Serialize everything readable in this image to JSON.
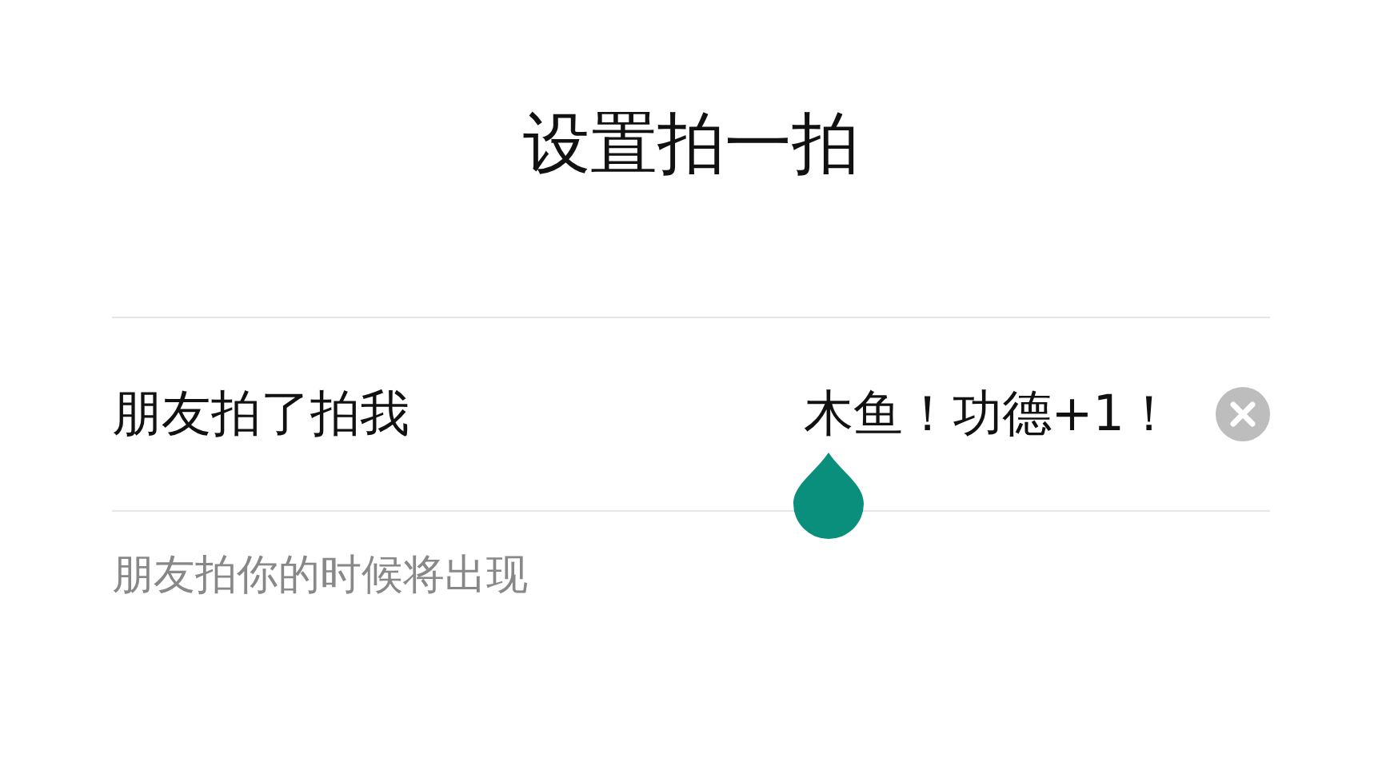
{
  "title": "设置拍一拍",
  "field": {
    "label": "朋友拍了拍我",
    "value": "木鱼！功德+1！"
  },
  "hint": "朋友拍你的时候将出现"
}
